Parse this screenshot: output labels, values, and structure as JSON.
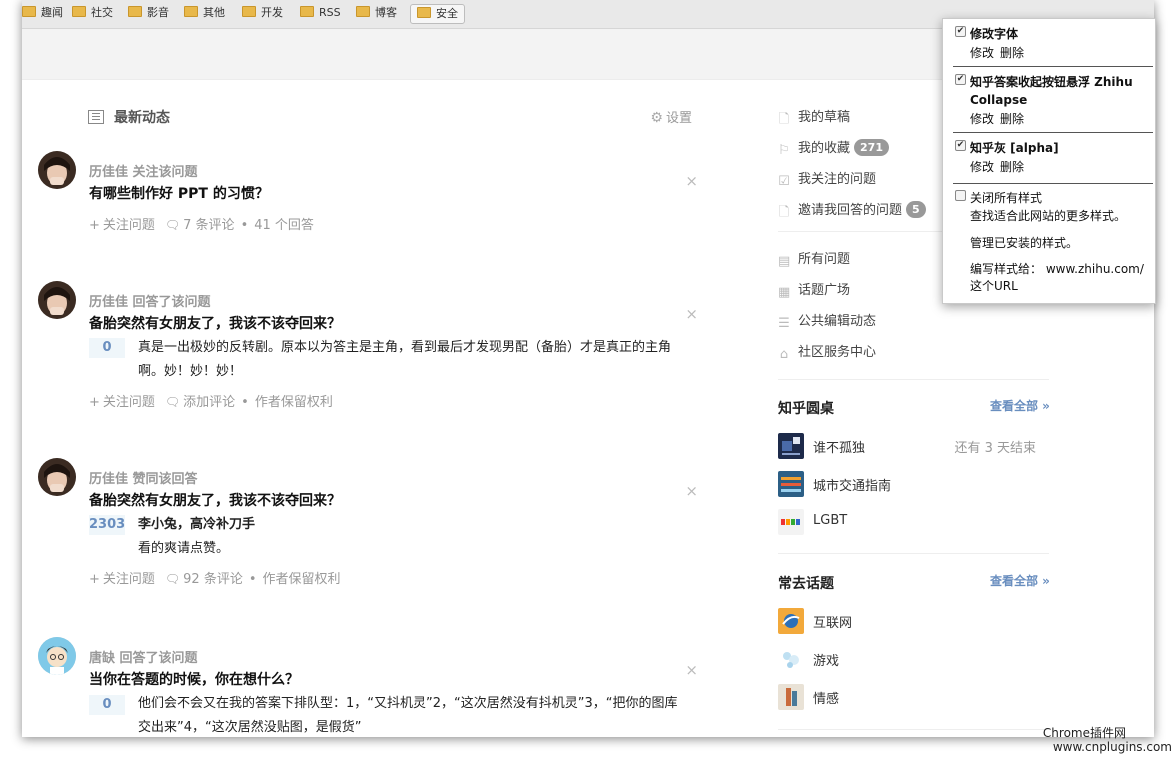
{
  "bookmarks": [
    {
      "label": "趣闻"
    },
    {
      "label": "社交"
    },
    {
      "label": "影音"
    },
    {
      "label": "其他"
    },
    {
      "label": "开发"
    },
    {
      "label": "RSS"
    },
    {
      "label": "博客"
    }
  ],
  "bookmark_button": "安全",
  "feed": {
    "title": "最新动态",
    "settings_label": "设置",
    "close_symbol": "×",
    "items": [
      {
        "meta": "历佳佳 关注该问题",
        "question": "有哪些制作好 PPT 的习惯？",
        "actions": {
          "follow": "关注问题",
          "comments": "7 条评论",
          "extra": "41 个回答"
        }
      },
      {
        "meta": "历佳佳 回答了该问题",
        "question": "备胎突然有女朋友了，我该不该夺回来？",
        "votes": "0",
        "answer": "真是一出极妙的反转剧。原本以为答主是主角，看到最后才发现男配（备胎）才是真正的主角啊。妙！妙！妙！",
        "actions": {
          "follow": "关注问题",
          "comments": "添加评论",
          "extra": "作者保留权利"
        }
      },
      {
        "meta": "历佳佳 赞同该回答",
        "question": "备胎突然有女朋友了，我该不该夺回来？",
        "votes": "2303",
        "author": "李小兔，高冷补刀手",
        "answer": "看的爽请点赞。",
        "actions": {
          "follow": "关注问题",
          "comments": "92 条评论",
          "extra": "作者保留权利"
        }
      },
      {
        "meta": "唐缺 回答了该问题",
        "question": "当你在答题的时候，你在想什么？",
        "votes": "0",
        "answer": "他们会不会又在我的答案下排队型：1，“又抖机灵”2，“这次居然没有抖机灵”3，“把你的图库交出来”4，“这次居然没贴图，是假货”"
      }
    ]
  },
  "sidebar": {
    "links_top": [
      {
        "label": "我的草稿",
        "icon": "draft-icon"
      },
      {
        "label": "我的收藏",
        "icon": "bookmark-icon",
        "badge": "271"
      },
      {
        "label": "我关注的问题",
        "icon": "check-icon"
      },
      {
        "label": "邀请我回答的问题",
        "icon": "invite-icon",
        "badge": "5"
      }
    ],
    "links_bottom": [
      {
        "label": "所有问题",
        "icon": "questions-icon"
      },
      {
        "label": "话题广场",
        "icon": "grid-icon"
      },
      {
        "label": "公共编辑动态",
        "icon": "list-icon"
      },
      {
        "label": "社区服务中心",
        "icon": "home-icon"
      }
    ],
    "roundtable": {
      "title": "知乎圆桌",
      "see_all": "查看全部 »",
      "items": [
        {
          "name": "谁不孤独",
          "extra": "还有 3 天结束"
        },
        {
          "name": "城市交通指南",
          "extra": ""
        },
        {
          "name": "LGBT",
          "extra": ""
        }
      ]
    },
    "topics": {
      "title": "常去话题",
      "see_all": "查看全部 »",
      "items": [
        {
          "name": "互联网"
        },
        {
          "name": "游戏"
        },
        {
          "name": "情感"
        }
      ]
    }
  },
  "popup": {
    "entries": [
      {
        "name": "修改字体",
        "checked": true,
        "edit": "修改",
        "delete": "删除"
      },
      {
        "name": "知乎答案收起按钮悬浮 Zhihu Collapse",
        "checked": true,
        "edit": "修改",
        "delete": "删除"
      },
      {
        "name": "知乎灰 [alpha]",
        "checked": true,
        "edit": "修改",
        "delete": "删除"
      }
    ],
    "disable_all": "关闭所有样式",
    "find_more": "查找适合此网站的更多样式。",
    "manage": "管理已安装的样式。",
    "write_for": "编写样式给： www.zhihu.com/",
    "this_url": "这个URL"
  },
  "watermark": {
    "line1": "Chrome插件网",
    "line2": "www.cnplugins.com"
  }
}
